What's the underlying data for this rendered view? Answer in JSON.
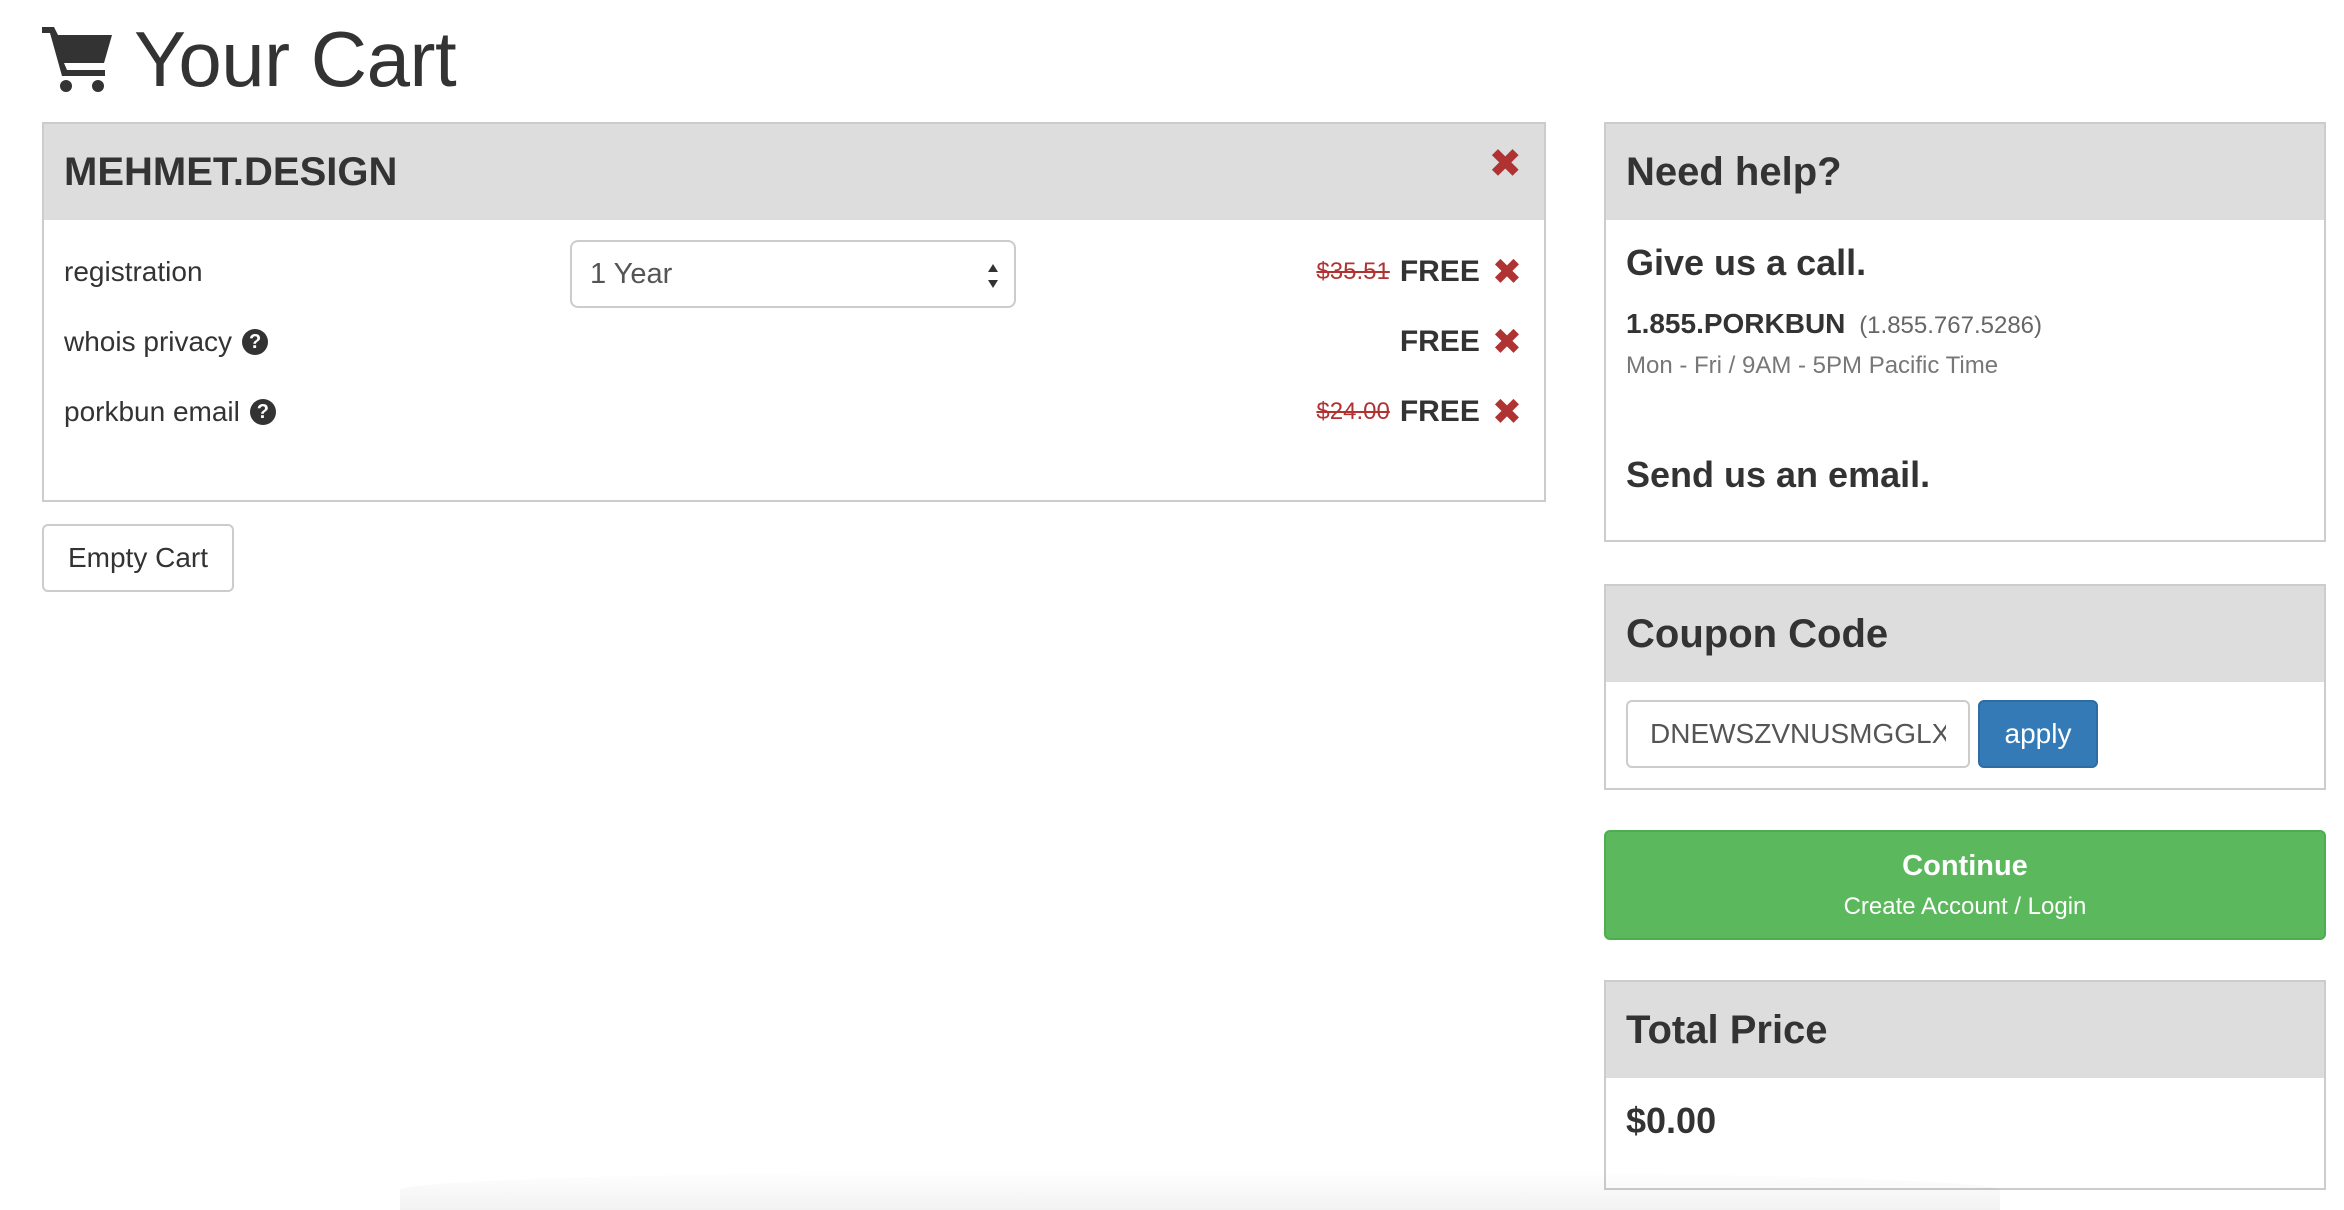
{
  "page": {
    "title": "Your Cart",
    "icon": "shopping-cart-icon"
  },
  "cart": {
    "domain": "MEHMET.DESIGN",
    "items": [
      {
        "label": "registration",
        "select_value": "1 Year",
        "old_price": "$35.51",
        "price": "FREE"
      },
      {
        "label": "whois privacy",
        "help_icon": "question-circle-icon",
        "price": "FREE"
      },
      {
        "label": "porkbun email",
        "help_icon": "question-circle-icon",
        "old_price": "$24.00",
        "price": "FREE"
      }
    ],
    "empty_cart_label": "Empty Cart",
    "remove_glyph": "✖"
  },
  "help": {
    "heading": "Need help?",
    "call_heading": "Give us a call.",
    "phone_main": "1.855.PORKBUN",
    "phone_alt": "(1.855.767.5286)",
    "hours": "Mon - Fri / 9AM - 5PM Pacific Time",
    "email_heading": "Send us an email."
  },
  "coupon": {
    "heading": "Coupon Code",
    "value": "DNEWSZVNUSMGGLX",
    "apply_label": "apply"
  },
  "continue": {
    "label": "Continue",
    "sublabel": "Create Account / Login"
  },
  "total": {
    "heading": "Total Price",
    "value": "$0.00"
  },
  "colors": {
    "remove": "#b03333",
    "primary": "#337ab7",
    "success": "#5cb85c",
    "panel_heading": "#dddddd"
  }
}
